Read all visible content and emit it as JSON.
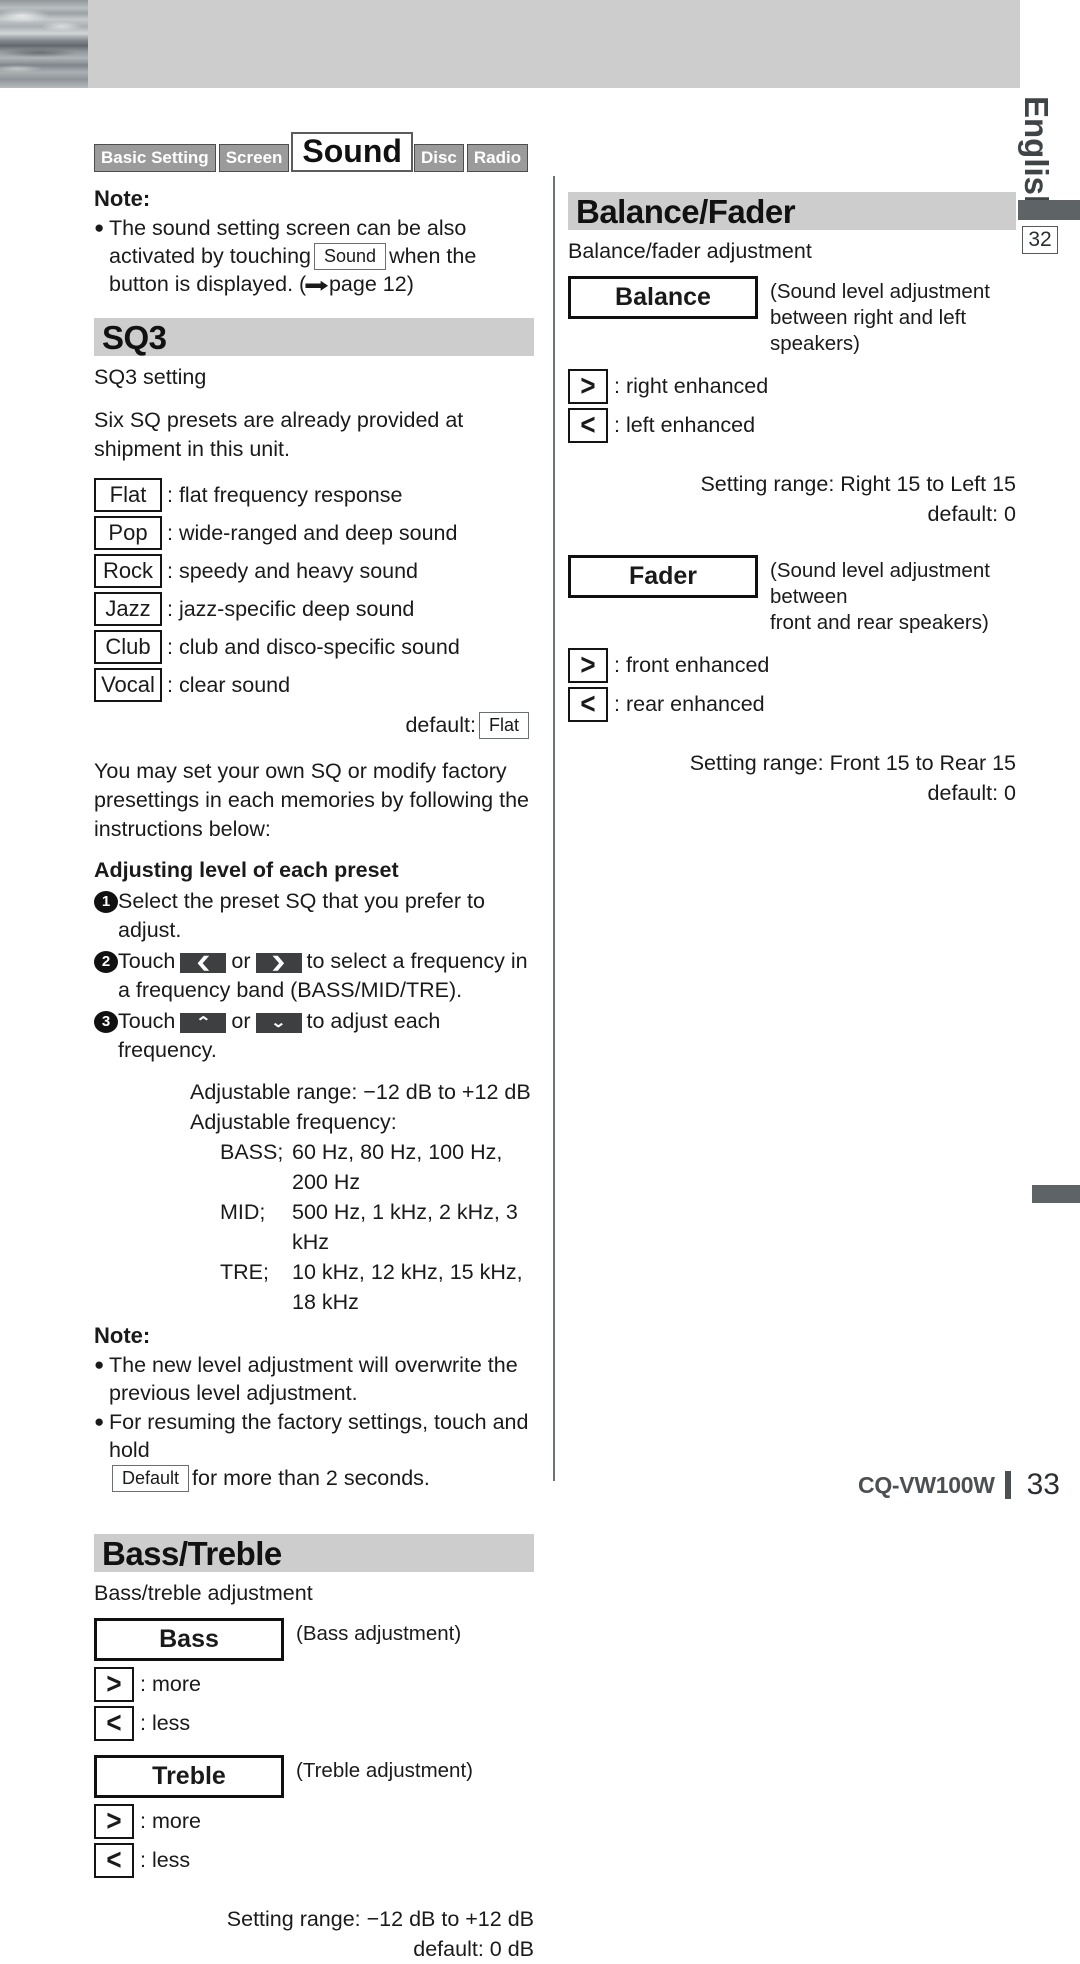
{
  "page": {
    "language_tab": "English",
    "page_ref_box": "32",
    "footer_model": "CQ-VW100W",
    "footer_page": "33"
  },
  "tabs": [
    {
      "label": "Basic Setting",
      "active": false
    },
    {
      "label": "Screen",
      "active": false
    },
    {
      "label": "Sound",
      "active": true
    },
    {
      "label": "Disc",
      "active": false
    },
    {
      "label": "Radio",
      "active": false
    }
  ],
  "top_note": {
    "title": "Note:",
    "bullet": "●",
    "text_before": "The sound setting screen can be also activated by touching",
    "key": "Sound",
    "text_after": "when the button is displayed. (",
    "arrow_icon": "➡",
    "page_ref": "page 12",
    "text_end": ")"
  },
  "sq3": {
    "heading": "SQ3",
    "subtitle": "SQ3 setting",
    "intro": "Six SQ presets are already provided at shipment in this unit.",
    "presets": [
      {
        "key": "Flat",
        "desc": ": flat frequency response"
      },
      {
        "key": "Pop",
        "desc": ": wide-ranged and deep sound"
      },
      {
        "key": "Rock",
        "desc": ": speedy and heavy sound"
      },
      {
        "key": "Jazz",
        "desc": ": jazz-specific deep sound"
      },
      {
        "key": "Club",
        "desc": ": club and disco-specific sound"
      },
      {
        "key": "Vocal",
        "desc": ": clear sound"
      }
    ],
    "default_label": "default:",
    "default_value": "Flat",
    "body": "You may set your own SQ or modify factory presettings in each memories by following the instructions below:",
    "adjust_heading": "Adjusting level of each preset",
    "steps": [
      {
        "num": "1",
        "text": "Select the preset SQ that you prefer to adjust."
      },
      {
        "num": "2",
        "prefix": "Touch",
        "btn_a": "❮",
        "mid": "or",
        "btn_b": "❯",
        "suffix": "to select a frequency in a frequency band (BASS/MID/TRE)."
      },
      {
        "num": "3",
        "prefix": "Touch",
        "btn_a": "⌃",
        "mid": "or",
        "btn_b": "⌄",
        "suffix": "to adjust each frequency."
      }
    ],
    "adjustable_range": "Adjustable range: −12 dB to +12 dB",
    "adjustable_frequency_label": "Adjustable frequency:",
    "frequencies": [
      {
        "band": "BASS;",
        "values": "60 Hz, 80 Hz, 100 Hz, 200 Hz"
      },
      {
        "band": "MID;",
        "values": "500 Hz, 1 kHz, 2 kHz, 3 kHz"
      },
      {
        "band": "TRE;",
        "values": "10 kHz, 12 kHz, 15 kHz, 18 kHz"
      }
    ],
    "note": {
      "title": "Note:",
      "bullet": "●",
      "item1": "The new level adjustment will overwrite the previous level adjustment.",
      "item2_before": "For resuming the factory settings, touch and hold",
      "item2_key": "Default",
      "item2_after": "for more than 2 seconds."
    }
  },
  "bass_treble": {
    "heading": "Bass/Treble",
    "subtitle": "Bass/treble adjustment",
    "bass": {
      "box_label": "Bass",
      "note": "(Bass adjustment)",
      "up_glyph": ">",
      "up_desc": ": more",
      "down_glyph": "<",
      "down_desc": ": less"
    },
    "treble": {
      "box_label": "Treble",
      "note": "(Treble adjustment)",
      "up_glyph": ">",
      "up_desc": ": more",
      "down_glyph": "<",
      "down_desc": ": less"
    },
    "range_line1": "Setting range: −12 dB to +12 dB",
    "range_line2": "default: 0 dB"
  },
  "balance_fader": {
    "heading": "Balance/Fader",
    "subtitle": "Balance/fader adjustment",
    "balance": {
      "box_label": "Balance",
      "note_line1": "(Sound level adjustment",
      "note_line2": "between right and left speakers)",
      "up_glyph": ">",
      "up_desc": ": right enhanced",
      "down_glyph": "<",
      "down_desc": ": left enhanced",
      "range_line1": "Setting range: Right 15 to Left 15",
      "range_line2": "default: 0"
    },
    "fader": {
      "box_label": "Fader",
      "note_line1": "(Sound level adjustment between",
      "note_line2": "front and rear speakers)",
      "up_glyph": ">",
      "up_desc": ": front enhanced",
      "down_glyph": "<",
      "down_desc": ": rear enhanced",
      "range_line1": "Setting range: Front 15 to Rear 15",
      "range_line2": "default: 0"
    }
  }
}
